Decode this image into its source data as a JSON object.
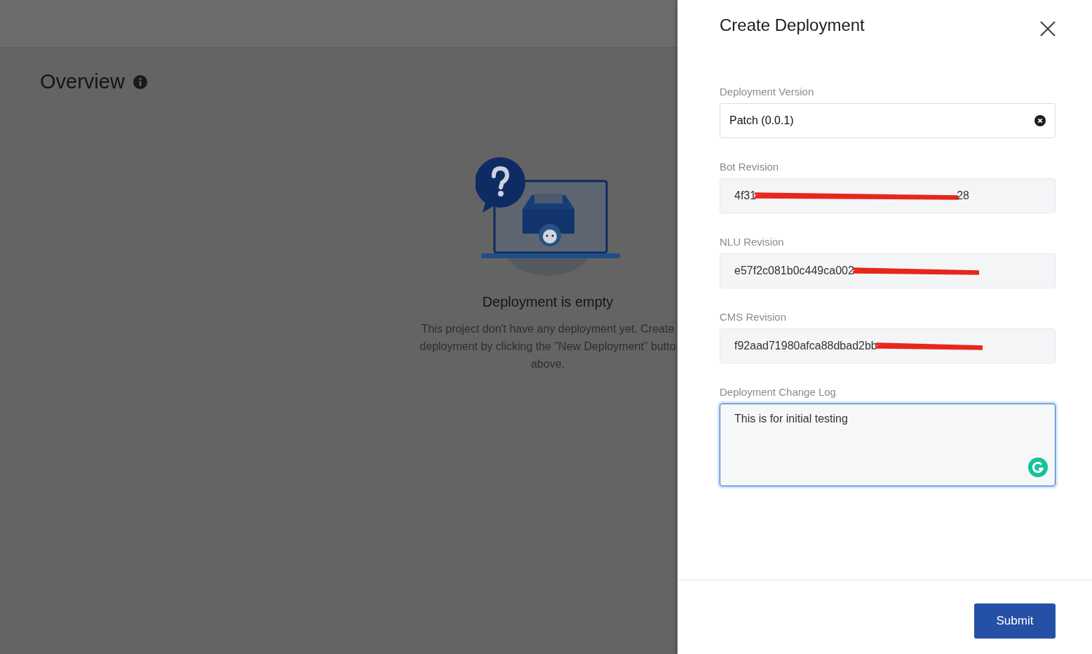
{
  "page": {
    "title": "Overview"
  },
  "empty_state": {
    "title": "Deployment is empty",
    "lines": [
      "This project don't have any deployment yet. Create",
      "deployment by clicking the \"New Deployment\" butto",
      "above."
    ]
  },
  "drawer": {
    "title": "Create Deployment",
    "fields": [
      {
        "label": "Deployment Version",
        "kind": "select",
        "value": "Patch (0.0.1)",
        "clearable": true
      },
      {
        "label": "Bot Revision",
        "kind": "readonly",
        "value": "4f31",
        "redacted": true,
        "value_end": "28"
      },
      {
        "label": "NLU Revision",
        "kind": "readonly",
        "value": "e57f2c081b0c449ca002",
        "redacted": true
      },
      {
        "label": "CMS Revision",
        "kind": "readonly",
        "value": "f92aad71980afca88dbad2bb",
        "redacted": true
      },
      {
        "label": "Deployment Change Log",
        "kind": "textarea",
        "value": "This is for initial testing",
        "focused": true
      }
    ],
    "submit": "Submit"
  }
}
